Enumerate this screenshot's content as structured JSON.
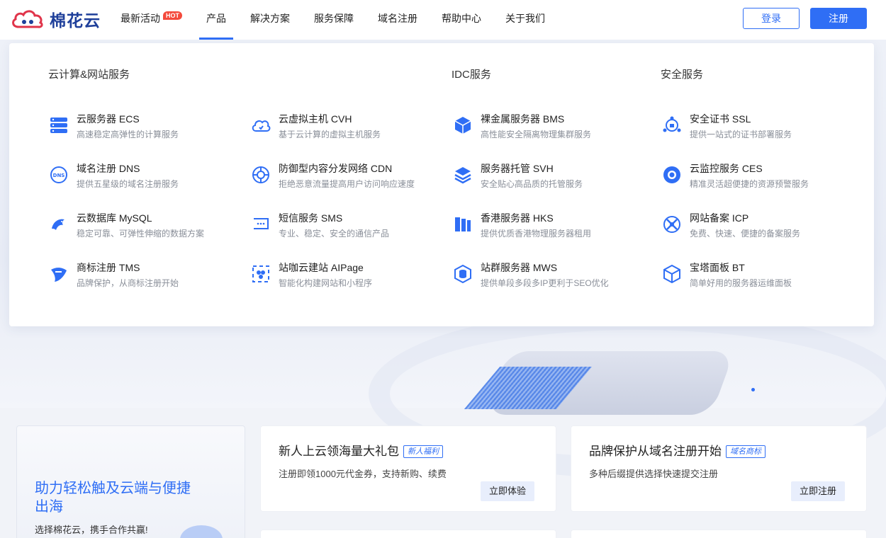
{
  "brand": {
    "name": "棉花云",
    "primary_color": "#2f6ef5",
    "logo_color": "#1e3f9a"
  },
  "nav": {
    "items": [
      {
        "label": "最新活动",
        "badge": "HOT"
      },
      {
        "label": "产品",
        "active": true
      },
      {
        "label": "解决方案"
      },
      {
        "label": "服务保障"
      },
      {
        "label": "域名注册"
      },
      {
        "label": "帮助中心"
      },
      {
        "label": "关于我们"
      }
    ],
    "login": "登录",
    "register": "注册"
  },
  "dropdown": {
    "categories": [
      "云计算&网站服务",
      "IDC服务",
      "安全服务"
    ],
    "columns": [
      [
        {
          "name": "云服务器 ECS",
          "desc": "高速稳定高弹性的计算服务",
          "icon": "server-stack-icon"
        },
        {
          "name": "域名注册 DNS",
          "desc": "提供五星级的域名注册服务",
          "icon": "dns-globe-icon"
        },
        {
          "name": "云数据库 MySQL",
          "desc": "稳定可靠、可弹性伸缩的数据方案",
          "icon": "dolphin-icon"
        },
        {
          "name": "商标注册 TMS",
          "desc": "品牌保护，从商标注册开始",
          "icon": "trademark-icon"
        }
      ],
      [
        {
          "name": "云虚拟主机 CVH",
          "desc": "基于云计算的虚拟主机服务",
          "icon": "cloud-icon"
        },
        {
          "name": "防御型内容分发网络 CDN",
          "desc": "拒绝恶意流量提高用户访问响应速度",
          "icon": "cdn-shield-icon"
        },
        {
          "name": "短信服务 SMS",
          "desc": "专业、稳定、安全的通信产品",
          "icon": "sms-icon"
        },
        {
          "name": "站咖云建站 AIPage",
          "desc": "智能化构建网站和小程序",
          "icon": "site-builder-icon"
        }
      ],
      [
        {
          "name": "裸金属服务器 BMS",
          "desc": "高性能安全隔离物理集群服务",
          "icon": "cube-icon"
        },
        {
          "name": "服务器托管 SVH",
          "desc": "安全贴心高品质的托管服务",
          "icon": "layers-icon"
        },
        {
          "name": "香港服务器 HKS",
          "desc": "提供优质香港物理服务器租用",
          "icon": "hk-server-icon"
        },
        {
          "name": "站群服务器 MWS",
          "desc": "提供单段多段多IP更利于SEO优化",
          "icon": "database-hex-icon"
        }
      ],
      [
        {
          "name": "安全证书 SSL",
          "desc": "提供一站式的证书部署服务",
          "icon": "certificate-icon"
        },
        {
          "name": "云监控服务 CES",
          "desc": "精准灵活超便捷的资源预警服务",
          "icon": "monitor-eye-icon"
        },
        {
          "name": "网站备案 ICP",
          "desc": "免费、快速、便捷的备案服务",
          "icon": "icp-icon"
        },
        {
          "name": "宝塔面板 BT",
          "desc": "简单好用的服务器运维面板",
          "icon": "panel-box-icon"
        }
      ]
    ]
  },
  "promo": {
    "left_title": "助力轻松触及云端与便捷出海",
    "left_sub": "选择棉花云，携手合作共赢!",
    "cards": [
      {
        "title": "新人上云领海量大礼包",
        "tag": "新人福利",
        "desc": "注册即领1000元代金券，支持新购、续费",
        "button": "立即体验"
      },
      {
        "title": "品牌保护从域名注册开始",
        "tag": "域名商标",
        "desc": "多种后缀提供选择快速提交注册",
        "button": "立即注册"
      }
    ]
  }
}
